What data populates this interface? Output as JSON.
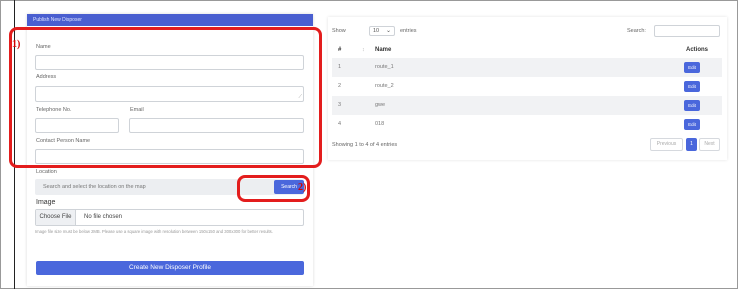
{
  "form": {
    "header": "Publish New Disposer",
    "name_label": "Name",
    "address_label": "Address",
    "telephone_label": "Telephone No.",
    "email_label": "Email",
    "contact_label": "Contact Person Name",
    "location_label": "Location",
    "location_placeholder": "Search and select the location on the map",
    "search_button": "Search",
    "image_label": "Image",
    "choose_file_button": "Choose File",
    "no_file_text": "No file chosen",
    "image_help": "Image file size must be below 2MB. Please use a square image with resolution between 150x150 and 300x300 for better results.",
    "create_button": "Create New Disposer Profile"
  },
  "annotations": {
    "box1": "1)",
    "box2": "2)"
  },
  "table": {
    "show_label": "Show",
    "entries_value": "10",
    "entries_label": "entries",
    "search_label": "Search:",
    "headers": [
      "#",
      "Name",
      "Actions"
    ],
    "rows": [
      {
        "num": "1",
        "name": "route_1",
        "action": "Edit"
      },
      {
        "num": "2",
        "name": "route_2",
        "action": "Edit"
      },
      {
        "num": "3",
        "name": "gwe",
        "action": "Edit"
      },
      {
        "num": "4",
        "name": "018",
        "action": "Edit"
      }
    ],
    "info": "Showing 1 to 4 of 4 entries",
    "pagination": {
      "previous": "Previous",
      "current": "1",
      "next": "Next"
    }
  },
  "colors": {
    "accent": "#4a67dc",
    "annotation": "#e31d1d"
  }
}
